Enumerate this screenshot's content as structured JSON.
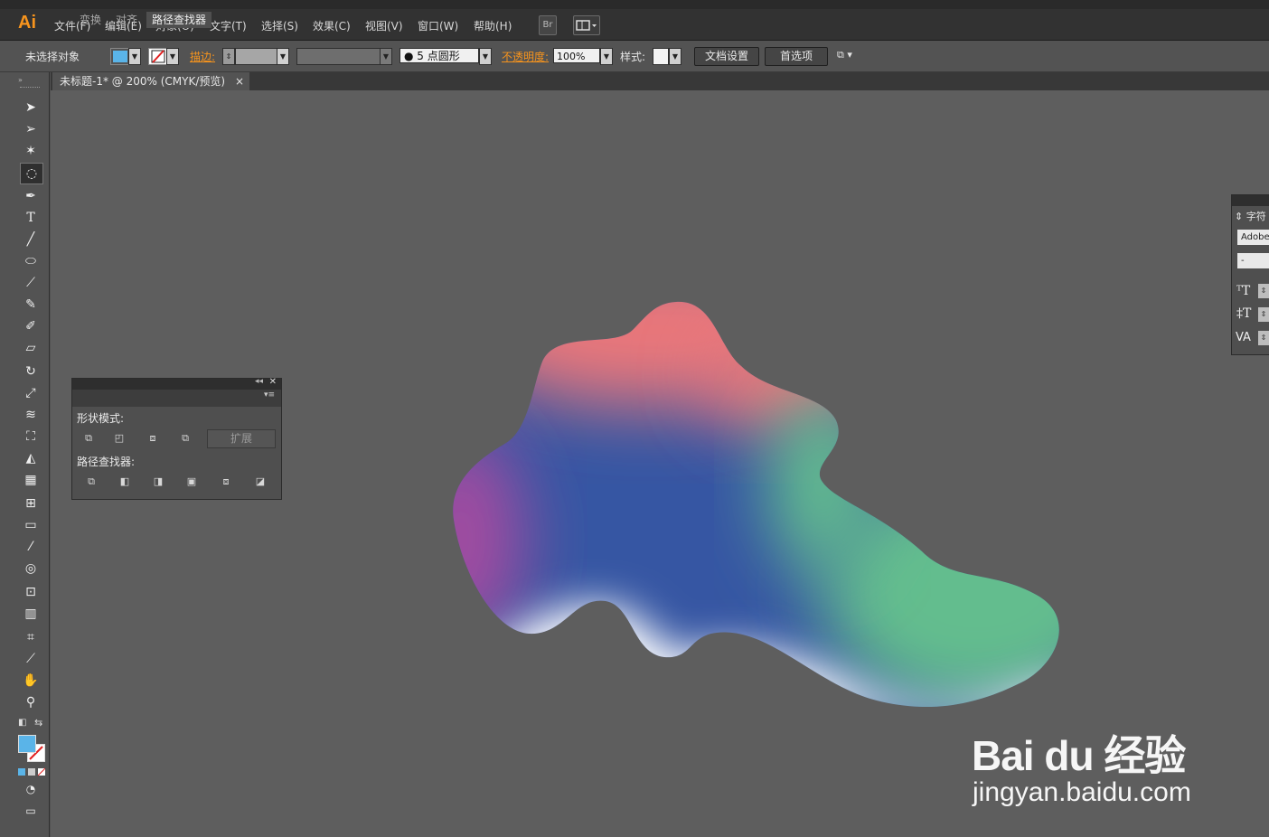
{
  "app": {
    "logo": "Ai"
  },
  "menu": [
    "文件(F)",
    "编辑(E)",
    "对象(O)",
    "文字(T)",
    "选择(S)",
    "效果(C)",
    "视图(V)",
    "窗口(W)",
    "帮助(H)"
  ],
  "menubar_buttons": {
    "bridge": "Br"
  },
  "control_bar": {
    "selection_status": "未选择对象",
    "fill_color": "#5ab4e8",
    "stroke_label": "描边:",
    "brush_label": "5 点圆形",
    "opacity_label": "不透明度:",
    "opacity_value": "100%",
    "style_label": "样式:",
    "doc_setup_button": "文档设置",
    "preferences_button": "首选项"
  },
  "document_tab": {
    "title": "未标题-1* @ 200% (CMYK/预览)",
    "close": "×"
  },
  "pathfinder_panel": {
    "tabs": [
      "变换",
      "对齐",
      "路径查找器"
    ],
    "active_tab": "路径查找器",
    "shape_modes_label": "形状模式:",
    "expand_button": "扩展",
    "pathfinders_label": "路径查找器:"
  },
  "character_panel": {
    "title": "字符",
    "font_value": "Adobe",
    "style_value": "-"
  },
  "artwork": {
    "gradient_colors": [
      "#e9777a",
      "#3656a3",
      "#64bd8e",
      "#a34ba0",
      "#ffffff"
    ]
  },
  "watermark": {
    "brand": "Bai du 经验",
    "url": "jingyan.baidu.com"
  }
}
